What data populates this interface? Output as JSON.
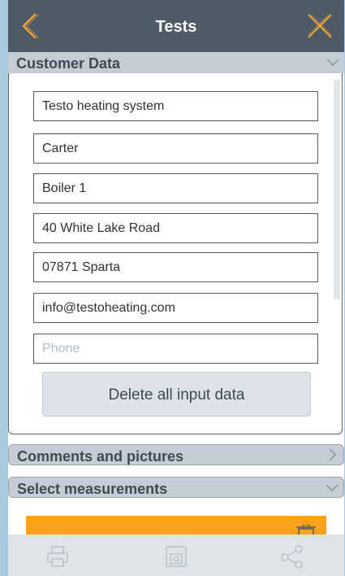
{
  "header": {
    "title": "Tests"
  },
  "sections": {
    "customer": {
      "label": "Customer Data"
    },
    "comments": {
      "label": "Comments and pictures"
    },
    "measurements": {
      "label": "Select measurements"
    }
  },
  "customer_fields": [
    {
      "value": "Testo heating system",
      "placeholder": ""
    },
    {
      "value": "Carter",
      "placeholder": ""
    },
    {
      "value": "Boiler 1",
      "placeholder": ""
    },
    {
      "value": "40 White Lake Road",
      "placeholder": ""
    },
    {
      "value": "07871 Sparta",
      "placeholder": ""
    },
    {
      "value": "info@testoheating.com",
      "placeholder": ""
    },
    {
      "value": "",
      "placeholder": "Phone"
    }
  ],
  "delete_button": {
    "label": "Delete all input data"
  },
  "colors": {
    "header": "#4e5b67",
    "accent_icon": "#f2a33a",
    "section_header": "#c5ccd3",
    "measurement_bar": "#f9a21a",
    "toolbar": "#dfe4e8"
  },
  "toolbar": {
    "icons": [
      "printer-icon",
      "save-icon",
      "share-icon"
    ]
  }
}
